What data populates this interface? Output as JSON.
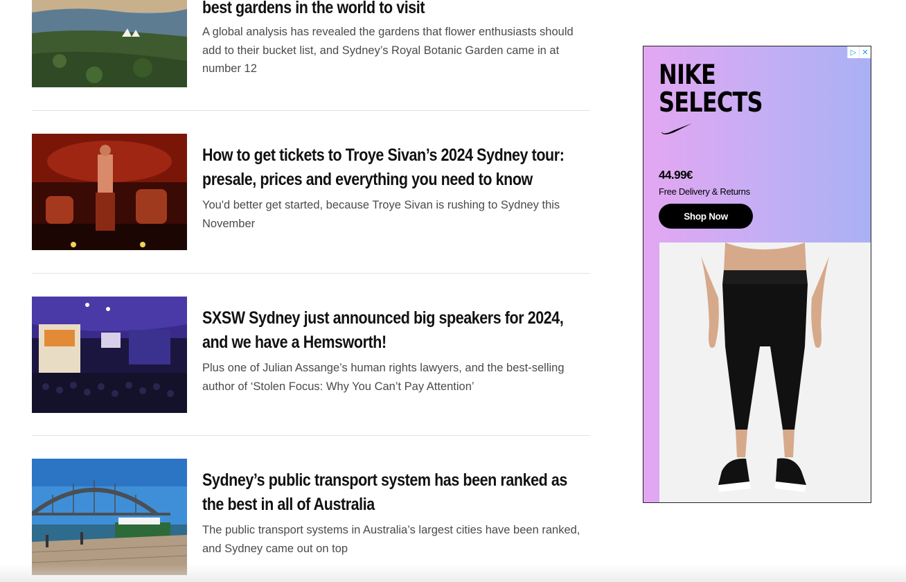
{
  "articles": [
    {
      "title": "best gardens in the world to visit",
      "description": "A global analysis has revealed the gardens that flower enthusiasts should add to their bucket list, and Sydney’s Royal Botanic Garden came in at number 12"
    },
    {
      "title": "How to get tickets to Troye Sivan’s 2024 Sydney tour: presale, prices and everything you need to know",
      "description": "You'd better get started, because Troye Sivan is rushing to Sydney this November"
    },
    {
      "title": "SXSW Sydney just announced big speakers for 2024, and we have a Hemsworth!",
      "description": "Plus one of Julian Assange’s human rights lawyers, and the best-selling author of ‘Stolen Focus: Why You Can’t Pay Attention’"
    },
    {
      "title": "Sydney’s public transport system has been ranked as the best in all of Australia",
      "description": "The public transport systems in Australia’s largest cities have been ranked, and Sydney came out on top"
    }
  ],
  "ad": {
    "brand_line1": "NIKE",
    "brand_line2": "SELECTS",
    "price": "44.99€",
    "delivery": "Free Delivery & Returns",
    "cta": "Shop Now",
    "adchoices_icon": "▷",
    "close_icon": "✕",
    "accent_color": "#000000"
  },
  "colors": {
    "gradient_left": "#e4a6f2",
    "gradient_right": "#aab0f5",
    "divider": "#e2e2e2"
  }
}
